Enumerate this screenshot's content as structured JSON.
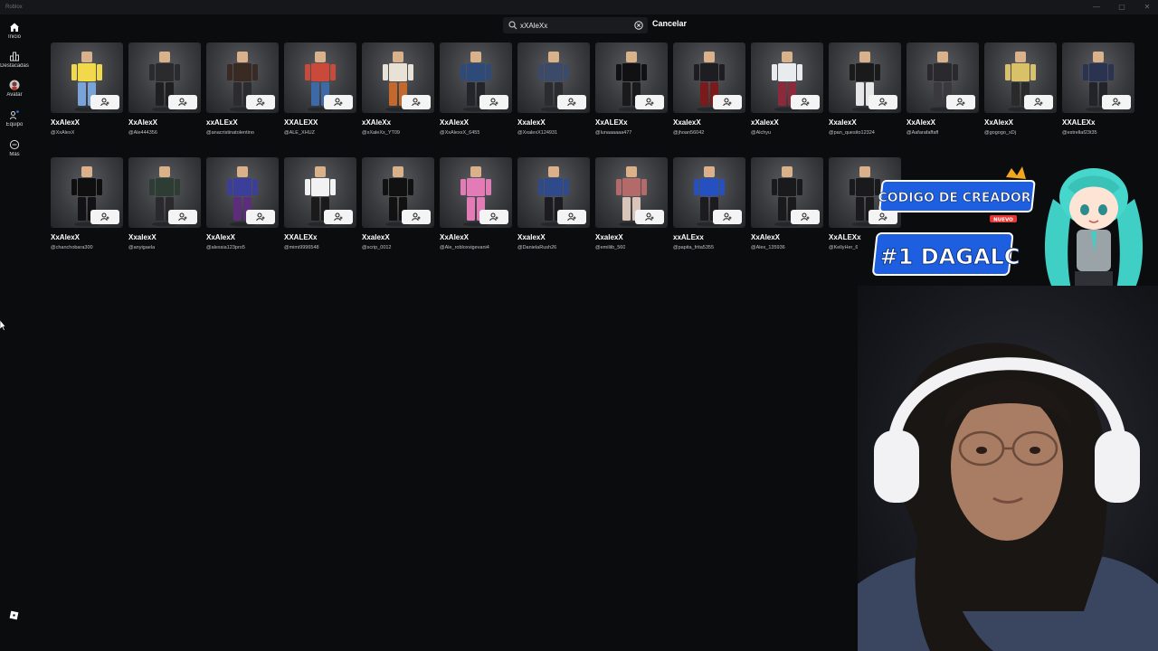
{
  "window": {
    "title": "Roblox"
  },
  "sidebar": {
    "items": [
      {
        "label": "Inicio",
        "icon": "home-icon"
      },
      {
        "label": "Destacadas",
        "icon": "charts-icon"
      },
      {
        "label": "Avatar",
        "icon": "avatar-icon"
      },
      {
        "label": "Equipo",
        "icon": "party-icon"
      },
      {
        "label": "Más",
        "icon": "more-icon"
      }
    ]
  },
  "search": {
    "value": "xXAleXx",
    "cancel_label": "Cancelar"
  },
  "results": [
    {
      "name": "XxAlexX",
      "handle": "@XxAlexX",
      "shirt": "#f2d84b",
      "pants": "#7aa4d8"
    },
    {
      "name": "XxAlexX",
      "handle": "@Ale444356",
      "shirt": "#2b2b2e",
      "pants": "#1f1f22"
    },
    {
      "name": "xxALExX",
      "handle": "@anacristinatolentino",
      "shirt": "#3a2a24",
      "pants": "#2c2c30"
    },
    {
      "name": "XXALEXX",
      "handle": "@ALE_XHUZ",
      "shirt": "#c94a3a",
      "pants": "#3d6aa6"
    },
    {
      "name": "xXAleXx",
      "handle": "@xXaleXx_YT09",
      "shirt": "#e8e2d6",
      "pants": "#c4682c"
    },
    {
      "name": "XxAlexX",
      "handle": "@XxAlexxX_6455",
      "shirt": "#2e4a78",
      "pants": "#23252a"
    },
    {
      "name": "XxalexX",
      "handle": "@XxalexX124931",
      "shirt": "#3a4a68",
      "pants": "#2a2c30"
    },
    {
      "name": "XxALEXx",
      "handle": "@lunaaaaaa477",
      "shirt": "#111113",
      "pants": "#1a1a1c"
    },
    {
      "name": "XxalexX",
      "handle": "@jhoan56042",
      "shirt": "#1e1e22",
      "pants": "#7a1a1a"
    },
    {
      "name": "xXalexX",
      "handle": "@Alchyu",
      "shirt": "#e9ecef",
      "pants": "#8a2a3a"
    },
    {
      "name": "XxalexX",
      "handle": "@pan_quesito12324",
      "shirt": "#1a1a1a",
      "pants": "#e6e6e6"
    },
    {
      "name": "XxAlexX",
      "handle": "@Aafarafaffaff",
      "shirt": "#2a2a2e",
      "pants": "#3a3a3e"
    },
    {
      "name": "XxAlexX",
      "handle": "@gogogo_xDj",
      "shirt": "#d9c16a",
      "pants": "#2a2a2a"
    },
    {
      "name": "XXALEXx",
      "handle": "@estrellaf23t35",
      "shirt": "#2a3450",
      "pants": "#22242a"
    },
    {
      "name": "XxAlexX",
      "handle": "@chanchobara300",
      "shirt": "#0f0f10",
      "pants": "#121214"
    },
    {
      "name": "XxalexX",
      "handle": "@anyigaela",
      "shirt": "#2e3d33",
      "pants": "#2a2a2e"
    },
    {
      "name": "XxAlexX",
      "handle": "@alessia123pro5",
      "shirt": "#3b3f9a",
      "pants": "#5b2d7a"
    },
    {
      "name": "XXALEXx",
      "handle": "@mimi9996548",
      "shirt": "#f2f2f2",
      "pants": "#1a1a1a"
    },
    {
      "name": "XxalexX",
      "handle": "@scrip_0012",
      "shirt": "#111112",
      "pants": "#111112"
    },
    {
      "name": "XxAlexX",
      "handle": "@Ale_robloxvigevani4",
      "shirt": "#e27bb6",
      "pants": "#e27bb6"
    },
    {
      "name": "XxalexX",
      "handle": "@DanielaRush26",
      "shirt": "#2f4a8a",
      "pants": "#1c1c20"
    },
    {
      "name": "XxalexX",
      "handle": "@emiliib_560",
      "shirt": "#b56a6a",
      "pants": "#d8c4b8"
    },
    {
      "name": "xxALExx",
      "handle": "@papita_frita5355",
      "shirt": "#2450c0",
      "pants": "#1c1c20"
    },
    {
      "name": "XxAlexX",
      "handle": "@Alex_135936",
      "shirt": "#1a1a1c",
      "pants": "#1a1a1c"
    },
    {
      "name": "XxALEXx",
      "handle": "@KellyHer_6",
      "shirt": "#1a1a1c",
      "pants": "#1a1a1c"
    }
  ],
  "overlay": {
    "banner_line1": "CODIGO DE CREADOR",
    "banner_line2": "#1 DAGALC",
    "banner_tag": "NUEVO"
  }
}
